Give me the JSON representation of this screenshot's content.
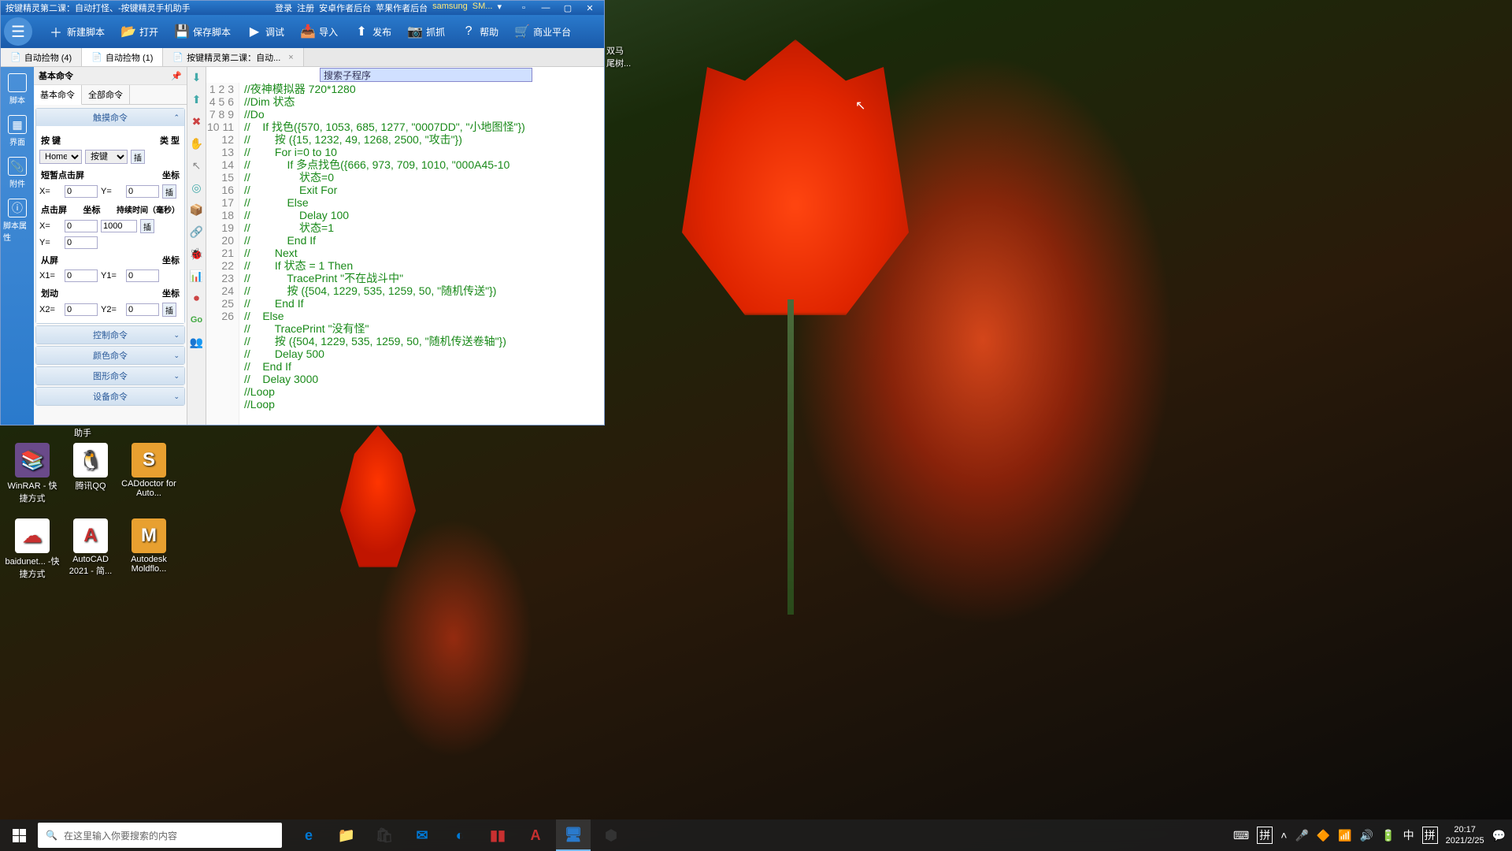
{
  "titlebar": {
    "title": "按键精灵第二课：自动打怪、-按键精灵手机助手",
    "links": [
      "登录",
      "注册",
      "安卓作者后台",
      "苹果作者后台",
      "samsung",
      "SM..."
    ],
    "dropdown": "▾"
  },
  "toolbar": {
    "items": [
      {
        "icon": "＋",
        "label": "新建脚本"
      },
      {
        "icon": "📂",
        "label": "打开"
      },
      {
        "icon": "💾",
        "label": "保存脚本"
      },
      {
        "icon": "▶",
        "label": "调试"
      },
      {
        "icon": "📥",
        "label": "导入"
      },
      {
        "icon": "⬆",
        "label": "发布"
      },
      {
        "icon": "📷",
        "label": "抓抓"
      },
      {
        "icon": "?",
        "label": "帮助"
      },
      {
        "icon": "🛒",
        "label": "商业平台"
      }
    ]
  },
  "tabs": [
    {
      "label": "自动捡物  (4)",
      "active": false
    },
    {
      "label": "自动捡物  (1)",
      "active": true
    },
    {
      "label": "按键精灵第二课：自动...",
      "active": false,
      "closable": true
    }
  ],
  "left_rail": [
    {
      "icon": "</>",
      "label": "脚本"
    },
    {
      "icon": "▦",
      "label": "界面"
    },
    {
      "icon": "📎",
      "label": "附件"
    },
    {
      "icon": "ⓘ",
      "label": "脚本属性"
    }
  ],
  "cmd_panel": {
    "header": "基本命令",
    "tabs": [
      "基本命令",
      "全部命令"
    ],
    "active_tab": 0,
    "accordions": {
      "touch": {
        "title": "触摸命令",
        "press": {
          "label1": "按 键",
          "label2": "类 型",
          "key_sel": "Home",
          "type_sel": "按键"
        },
        "tap_short": {
          "title": "短暂点击屏",
          "coord_lbl": "坐标",
          "x_lbl": "X=",
          "x": "0",
          "y_lbl": "Y=",
          "y": "0"
        },
        "tap": {
          "title": "点击屏",
          "coord_lbl": "坐标",
          "dur_lbl": "持续时间（毫秒）",
          "x_lbl": "X=",
          "x": "0",
          "y_lbl": "Y=",
          "y": "0",
          "dur": "1000"
        },
        "swipe_from": {
          "title": "从屏",
          "coord_lbl": "坐标",
          "x1_lbl": "X1=",
          "x1": "0",
          "y1_lbl": "Y1=",
          "y1": "0"
        },
        "swipe_to": {
          "title": "划动",
          "coord_lbl": "坐标",
          "x2_lbl": "X2=",
          "x2": "0",
          "y2_lbl": "Y2=",
          "y2": "0"
        }
      },
      "others": [
        "控制命令",
        "颜色命令",
        "图形命令",
        "设备命令"
      ]
    }
  },
  "search_placeholder": "搜索子程序",
  "code": {
    "lines": [
      "//夜神模拟器 720*1280",
      "//Dim 状态",
      "//Do",
      "//    If 找色({570, 1053, 685, 1277, \"0007DD\", \"小地图怪\"})",
      "//        按 ({15, 1232, 49, 1268, 2500, \"攻击\"})",
      "//        For i=0 to 10",
      "//            If 多点找色({666, 973, 709, 1010, \"000A45-10",
      "//                状态=0",
      "//                Exit For",
      "//            Else",
      "//                Delay 100",
      "//                状态=1",
      "//            End If",
      "//        Next",
      "//        If 状态 = 1 Then",
      "//            TracePrint \"不在战斗中\"",
      "//            按 ({504, 1229, 535, 1259, 50, \"随机传送\"})",
      "//        End If",
      "//    Else",
      "//        TracePrint \"没有怪\"",
      "//        按 ({504, 1229, 535, 1259, 50, \"随机传送卷轴\"})",
      "//        Delay 500",
      "//    End If",
      "//    Delay 3000",
      "//Loop",
      "//Loop"
    ]
  },
  "partial_label": "双马\n尾树...",
  "helper_label": "助手",
  "desktop_icons_row1": [
    {
      "label": "WinRAR - 快捷方式",
      "bg": "#6a4a8a",
      "glyph": "📚"
    },
    {
      "label": "腾讯QQ",
      "bg": "#fff",
      "glyph": "🐧"
    },
    {
      "label": "CADdoctor for Auto...",
      "bg": "#e8a030",
      "glyph": "S"
    }
  ],
  "desktop_icons_row2": [
    {
      "label": "baidunet... -快捷方式",
      "bg": "#fff",
      "glyph": "☁"
    },
    {
      "label": "AutoCAD 2021 - 简...",
      "bg": "#fff",
      "glyph": "A"
    },
    {
      "label": "Autodesk Moldflo...",
      "bg": "#e8a030",
      "glyph": "M"
    }
  ],
  "taskbar": {
    "search_placeholder": "在这里输入你要搜索的内容",
    "apps": [
      {
        "glyph": "e",
        "color": "#0078d4",
        "active": false
      },
      {
        "glyph": "📁",
        "color": "#ffb840",
        "active": false
      },
      {
        "glyph": "🛍",
        "color": "#333",
        "active": false
      },
      {
        "glyph": "✉",
        "color": "#0078d4",
        "active": false
      },
      {
        "glyph": "◐",
        "color": "#0078d4",
        "active": false
      },
      {
        "glyph": "▮▮",
        "color": "#c83030",
        "active": false
      },
      {
        "glyph": "A",
        "color": "#c83030",
        "active": false
      },
      {
        "glyph": "🖥",
        "color": "#2a7acc",
        "active": true
      },
      {
        "glyph": "⬢",
        "color": "#333",
        "active": false
      }
    ],
    "tray": {
      "ime1": "拼",
      "ime2": "中",
      "ime3": "拼",
      "time": "20:17",
      "date": "2021/2/25"
    }
  }
}
